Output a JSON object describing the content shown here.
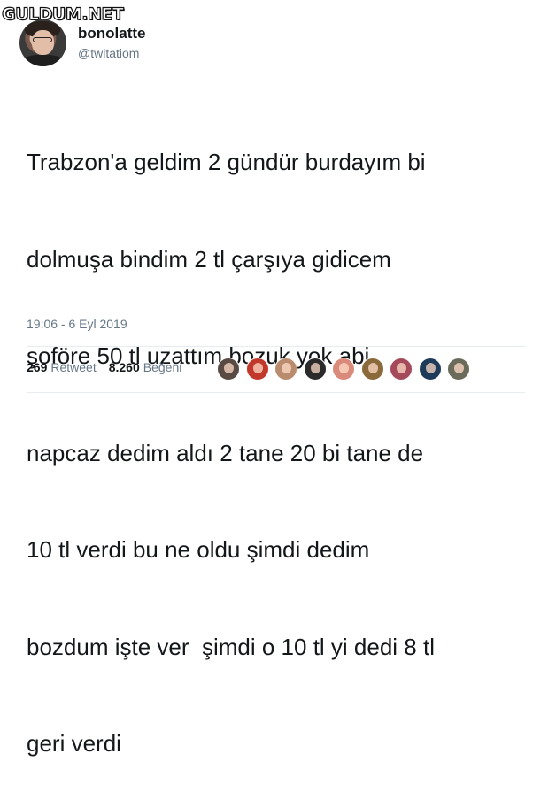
{
  "watermark": "GULDUM.NET",
  "user": {
    "display_name": "bonolatte",
    "handle": "@twitatiom"
  },
  "tweet": {
    "lines": [
      "Trabzon'a geldim 2 gündür burdayım bi",
      "dolmuşa bindim 2 tl çarşıya gidicem",
      "şoföre 50 tl uzattım bozuk yok abi",
      "napcaz dedim aldı 2 tane 20 bi tane de",
      "10 tl verdi bu ne oldu şimdi dedim",
      "bozdum işte ver  şimdi o 10 tl yi dedi 8 tl",
      "geri verdi"
    ],
    "timestamp": "19:06 - 6 Eyl 2019"
  },
  "stats": {
    "retweet_count": "269",
    "retweet_label": "Retweet",
    "like_count": "8.260",
    "like_label": "Beğeni"
  },
  "likers": [
    {
      "icon": "avatar",
      "color": "#5a4a44"
    },
    {
      "icon": "avatar",
      "color": "#c0392b"
    },
    {
      "icon": "avatar",
      "color": "#b98c6e"
    },
    {
      "icon": "avatar",
      "color": "#2b2b2b"
    },
    {
      "icon": "avatar",
      "color": "#d98a7a"
    },
    {
      "icon": "avatar",
      "color": "#8a6a3a"
    },
    {
      "icon": "avatar",
      "color": "#a44a5a"
    },
    {
      "icon": "avatar",
      "color": "#1f3b5a"
    },
    {
      "icon": "avatar",
      "color": "#6b6b5b"
    }
  ]
}
